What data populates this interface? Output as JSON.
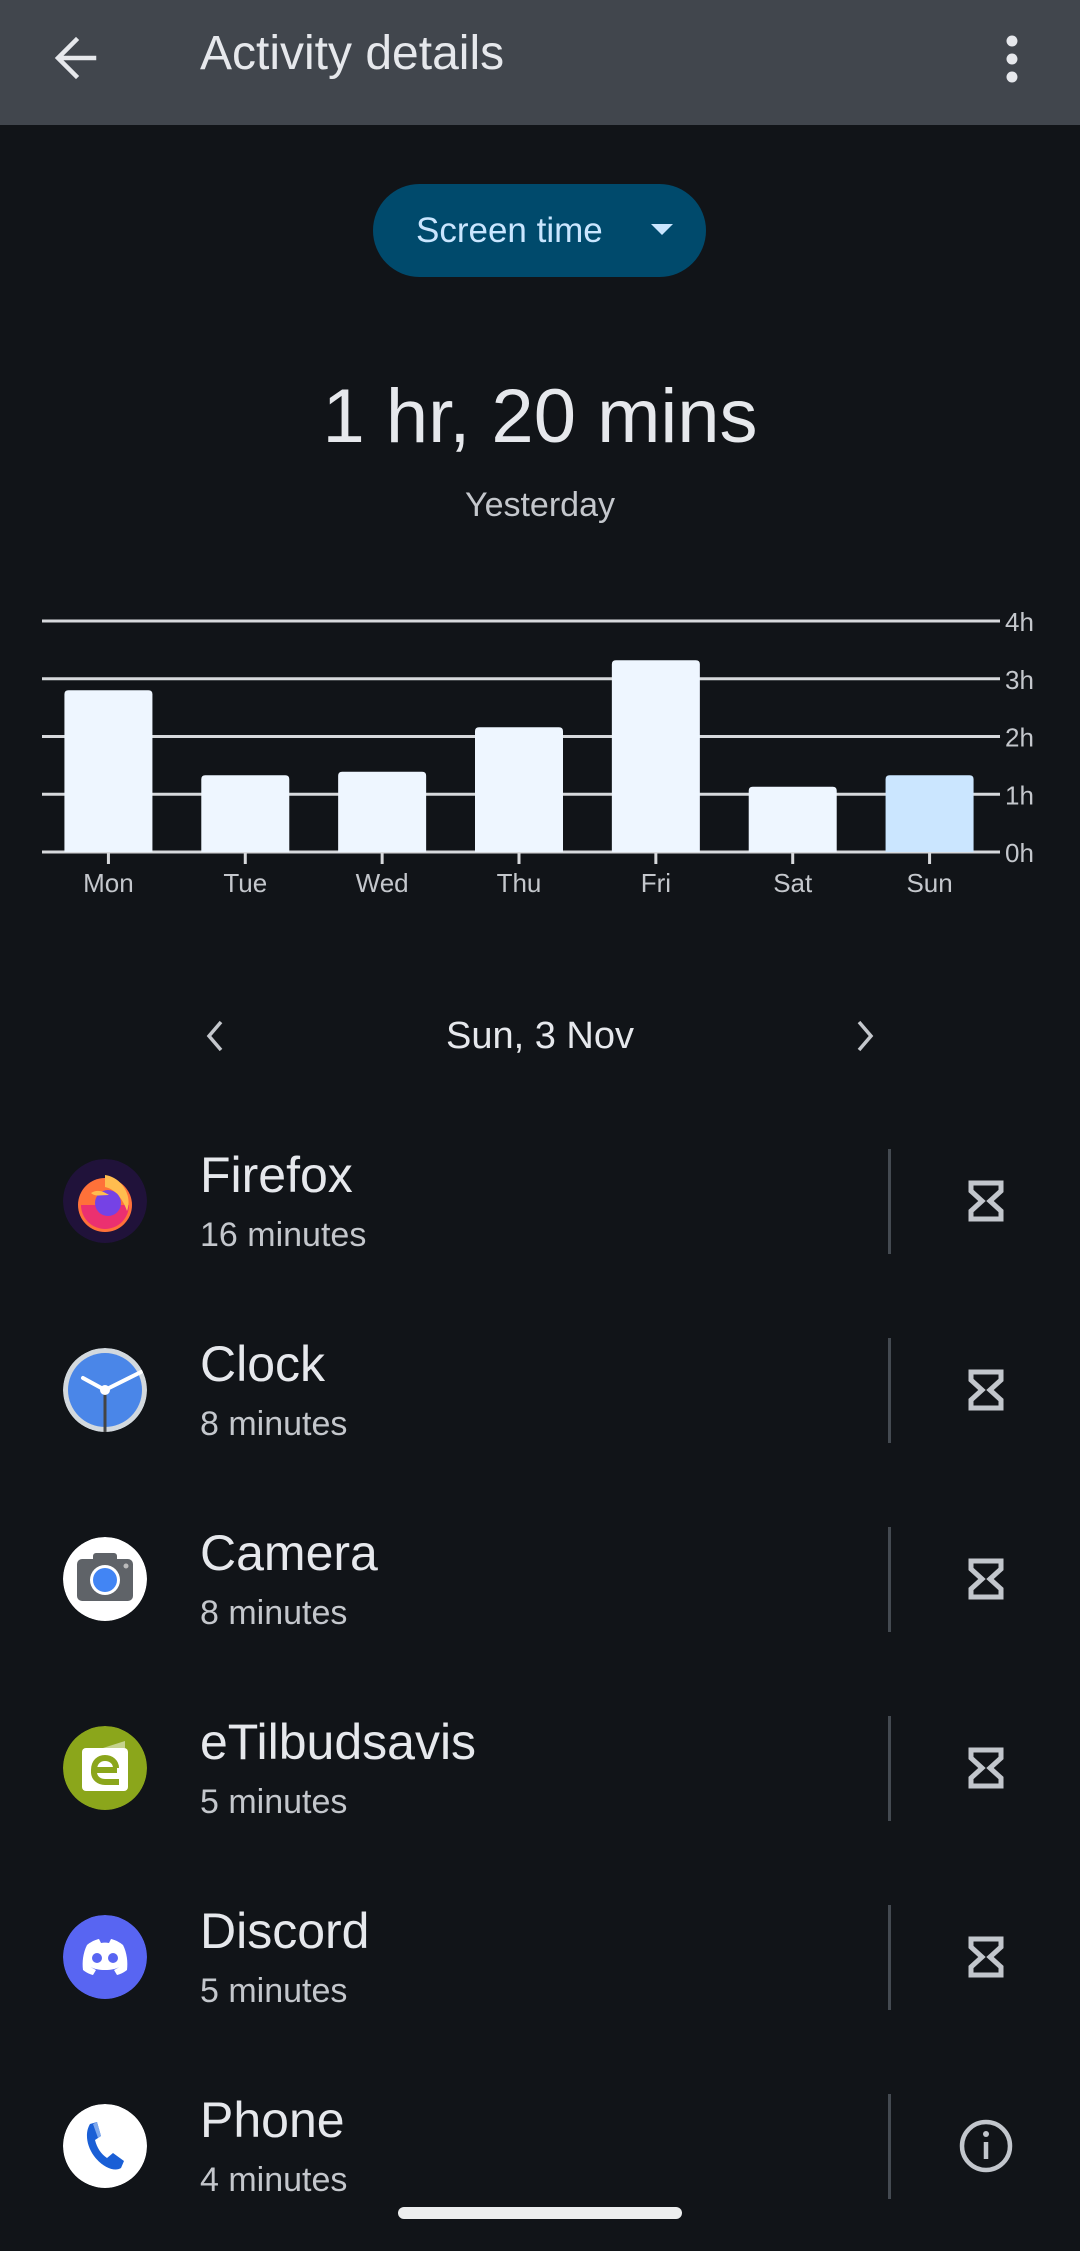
{
  "app_bar": {
    "title": "Activity details",
    "back_icon": "arrow-back-icon",
    "menu_icon": "more-vert-icon"
  },
  "metric_selector": {
    "label": "Screen time",
    "icon": "dropdown-caret-icon"
  },
  "summary": {
    "total": "1 hr, 20 mins",
    "period": "Yesterday"
  },
  "colors": {
    "app_bar": "#41464d",
    "background": "#111418",
    "pill": "#004a6c",
    "pill_text": "#cae6ff",
    "bar": "#eef6ff",
    "bar_selected": "#cbe6ff"
  },
  "chart_data": {
    "type": "bar",
    "title": "",
    "xlabel": "",
    "ylabel": "",
    "categories": [
      "Mon",
      "Tue",
      "Wed",
      "Thu",
      "Fri",
      "Sat",
      "Sun"
    ],
    "values": [
      2.8,
      1.33,
      1.39,
      2.16,
      3.32,
      1.13,
      1.33
    ],
    "unit": "hours",
    "ylim": [
      0,
      4
    ],
    "yticks": [
      "0h",
      "1h",
      "2h",
      "3h",
      "4h"
    ],
    "y_axis_position": "right",
    "grid": true,
    "selected_category": "Sun"
  },
  "date_nav": {
    "date": "Sun, 3 Nov",
    "prev_icon": "chevron-left-icon",
    "next_icon": "chevron-right-icon"
  },
  "apps": [
    {
      "name": "Firefox",
      "time": "16 minutes",
      "icon": "firefox-icon",
      "action": "timer-icon"
    },
    {
      "name": "Clock",
      "time": "8 minutes",
      "icon": "clock-icon",
      "action": "timer-icon"
    },
    {
      "name": "Camera",
      "time": "8 minutes",
      "icon": "camera-icon",
      "action": "timer-icon"
    },
    {
      "name": "eTilbudsavis",
      "time": "5 minutes",
      "icon": "etilbudsavis-icon",
      "action": "timer-icon"
    },
    {
      "name": "Discord",
      "time": "5 minutes",
      "icon": "discord-icon",
      "action": "timer-icon"
    },
    {
      "name": "Phone",
      "time": "4 minutes",
      "icon": "phone-icon",
      "action": "info-icon"
    }
  ]
}
